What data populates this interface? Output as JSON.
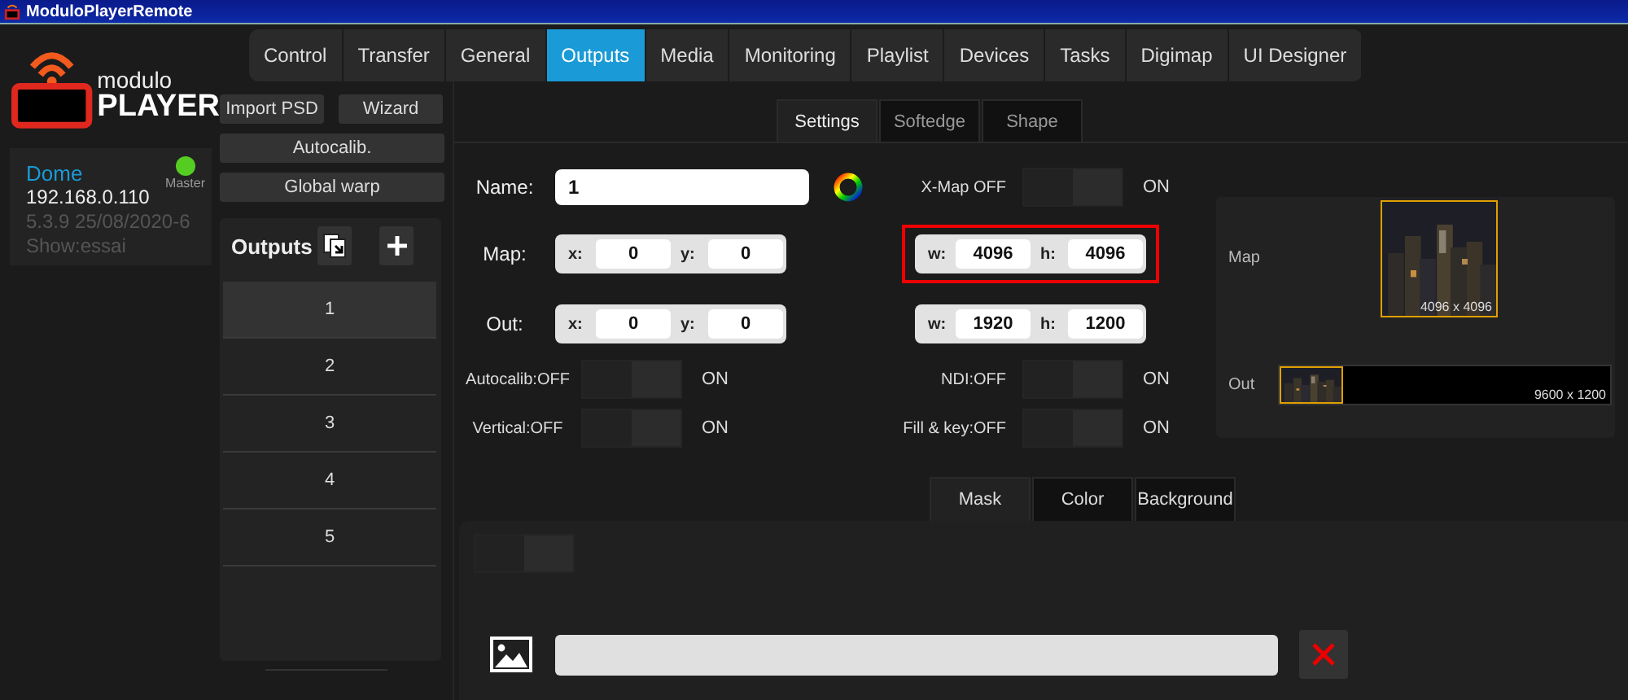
{
  "window": {
    "title": "ModuloPlayerRemote"
  },
  "logo": {
    "line_1": "modulo",
    "line_2": "PLAYER"
  },
  "device": {
    "name": "Dome",
    "address": "192.168.0.110",
    "version": "5.3.9 25/08/2020-6",
    "show": "Show:essai",
    "master": {
      "label": "Master",
      "online": true
    }
  },
  "tabs": [
    {
      "label": "Control",
      "selected": false
    },
    {
      "label": "Transfer",
      "selected": false
    },
    {
      "label": "General",
      "selected": false
    },
    {
      "label": "Outputs",
      "selected": true
    },
    {
      "label": "Media",
      "selected": false
    },
    {
      "label": "Monitoring",
      "selected": false
    },
    {
      "label": "Playlist",
      "selected": false
    },
    {
      "label": "Devices",
      "selected": false
    },
    {
      "label": "Tasks",
      "selected": false
    },
    {
      "label": "Digimap",
      "selected": false
    },
    {
      "label": "UI Designer",
      "selected": false
    }
  ],
  "actions": [
    {
      "label": "Import PSD",
      "kind": "half"
    },
    {
      "label": "Wizard",
      "kind": "half"
    },
    {
      "label": "Autocalib.",
      "kind": "full"
    },
    {
      "label": "Global warp",
      "kind": "full"
    }
  ],
  "outputs": {
    "title": "Outputs",
    "items": [
      {
        "label": "1",
        "selected": true
      },
      {
        "label": "2",
        "selected": false
      },
      {
        "label": "3",
        "selected": false
      },
      {
        "label": "4",
        "selected": false
      },
      {
        "label": "5",
        "selected": false
      }
    ]
  },
  "sub_tabs": [
    {
      "label": "Settings",
      "selected": true
    },
    {
      "label": "Softedge",
      "selected": false
    },
    {
      "label": "Shape",
      "selected": false
    }
  ],
  "settings": {
    "name": {
      "label": "Name:",
      "value": "1"
    },
    "x_map": {
      "label": "X-Map OFF",
      "on": false,
      "on_label": "ON"
    },
    "map": {
      "label": "Map:",
      "x": {
        "label": "x:",
        "value": "0"
      },
      "y": {
        "label": "y:",
        "value": "0"
      },
      "w": {
        "label": "w:",
        "value": "4096"
      },
      "h": {
        "label": "h:",
        "value": "4096"
      },
      "highlighted": true
    },
    "out": {
      "label": "Out:",
      "x": {
        "label": "x:",
        "value": "0"
      },
      "y": {
        "label": "y:",
        "value": "0"
      },
      "w": {
        "label": "w:",
        "value": "1920"
      },
      "h": {
        "label": "h:",
        "value": "1200"
      },
      "highlighted": false
    },
    "toggles_left": [
      {
        "label": "Autocalib:OFF",
        "on": false,
        "on_label": "ON"
      },
      {
        "label": "Vertical:OFF",
        "on": false,
        "on_label": "ON"
      }
    ],
    "toggles_right": [
      {
        "label": "NDI:OFF",
        "on": false,
        "on_label": "ON"
      },
      {
        "label": "Fill & key:OFF",
        "on": false,
        "on_label": "ON"
      }
    ]
  },
  "preview": {
    "map": {
      "label": "Map",
      "size": "4096 x 4096"
    },
    "out": {
      "label": "Out",
      "size": "9600 x 1200"
    }
  },
  "mask_tabs": [
    {
      "label": "Mask",
      "selected": true
    },
    {
      "label": "Color",
      "selected": false
    },
    {
      "label": "Background",
      "selected": false
    }
  ],
  "mask": {
    "toggle": {
      "on": false
    }
  }
}
